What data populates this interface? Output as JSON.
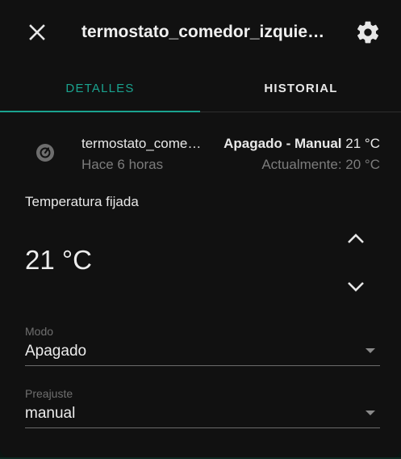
{
  "dialog": {
    "title": "termostato_comedor_izquierdo",
    "close_icon": "close-icon",
    "settings_icon": "gear-icon"
  },
  "tabs": [
    {
      "label": "DETALLES",
      "active": true
    },
    {
      "label": "HISTORIAL",
      "active": false
    }
  ],
  "accent_color": "#1aa38f",
  "entity": {
    "icon": "thermostat-icon",
    "name": "termostato_comedor_izquierdo",
    "last_changed": "Hace 6 horas",
    "state_bold": "Apagado - Manual",
    "state_temp": "21 °C",
    "current": "Actualmente: 20 °C"
  },
  "setpoint": {
    "label": "Temperatura fijada",
    "value": "21 °C"
  },
  "mode_select": {
    "label": "Modo",
    "value": "Apagado"
  },
  "preset_select": {
    "label": "Preajuste",
    "value": "manual"
  }
}
